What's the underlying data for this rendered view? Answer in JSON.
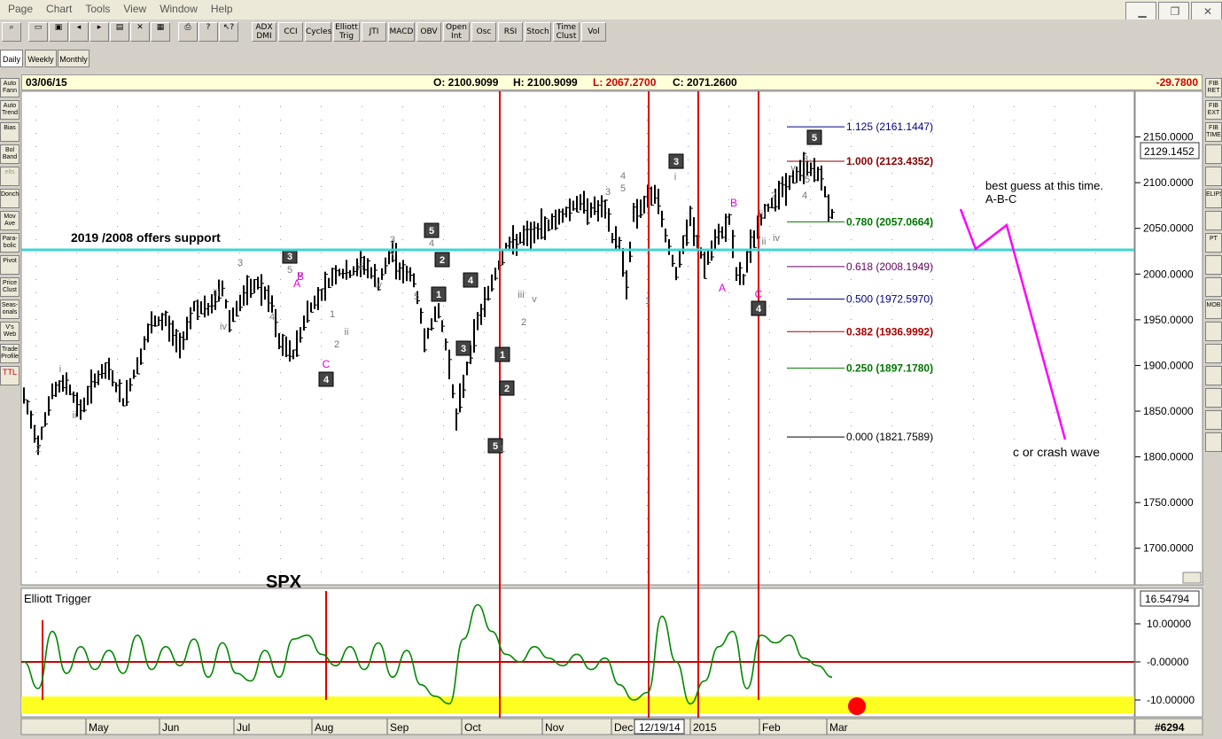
{
  "menu": [
    "Page",
    "Chart",
    "Tools",
    "View",
    "Window",
    "Help"
  ],
  "toolbar": {
    "indicators": [
      {
        "id": "adx",
        "label": "ADX DMI"
      },
      {
        "id": "cci",
        "label": "CCI"
      },
      {
        "id": "cycles",
        "label": "Cycles"
      },
      {
        "id": "elliott",
        "label": "Elliott Trig"
      },
      {
        "id": "jti",
        "label": "JTI"
      },
      {
        "id": "macd",
        "label": "MACD"
      },
      {
        "id": "obv",
        "label": "OBV"
      },
      {
        "id": "openint",
        "label": "Open Int"
      },
      {
        "id": "osc",
        "label": "Osc"
      },
      {
        "id": "rsi",
        "label": "RSI"
      },
      {
        "id": "stoch",
        "label": "Stoch"
      },
      {
        "id": "timeclust",
        "label": "Time Clust"
      },
      {
        "id": "vol",
        "label": "Vol"
      }
    ]
  },
  "tabs": [
    "Daily",
    "Weekly",
    "Monthly"
  ],
  "left_tools": [
    "Auto Fann",
    "Auto Trend",
    "Bias",
    "Bol Band",
    "elts",
    "Donch",
    "Mov Ave",
    "Para- bolic",
    "Pivot",
    "Price Clust",
    "Seas- onals",
    "V's Web",
    "Trade Profile",
    "TTL"
  ],
  "right_tools": [
    "FIB RET",
    "FIB EXT",
    "FIB TIME",
    "",
    "",
    "ELIPSE",
    "",
    "PT",
    "",
    "",
    "MOB",
    "",
    "",
    "",
    "",
    "",
    ""
  ],
  "info": {
    "date": "03/06/15",
    "open": "O: 2100.9099",
    "high": "H: 2100.9099",
    "low": "L: 2067.2700",
    "close": "C: 2071.2600",
    "change": "-29.7800"
  },
  "colors": {
    "support": "#3fd4d4",
    "cycle": "#dd0000",
    "price": "#000000",
    "abc": "#ff00ff",
    "trigger": "#008800",
    "zero": "#cc0000",
    "highlight": "#ffff22"
  },
  "price_axis": {
    "ticks": [
      "2150.0000",
      "2100.0000",
      "2050.0000",
      "2000.0000",
      "1950.0000",
      "1900.0000",
      "1850.0000",
      "1800.0000",
      "1750.0000",
      "1700.0000"
    ],
    "current": "2129.1452"
  },
  "trigger_axis": {
    "ticks": [
      "10.00000",
      "-0.00000",
      "-10.00000"
    ],
    "current": "16.54794"
  },
  "months": [
    "May",
    "Jun",
    "Jul",
    "Aug",
    "Sep",
    "Oct",
    "Nov",
    "Dec",
    "12/19/14",
    "2015",
    "Feb",
    "Mar"
  ],
  "bar_count": "#6294",
  "fib_levels": [
    {
      "label": "1.125 (2161.1447)",
      "color": "#000088"
    },
    {
      "label": "1.000 (2123.4352)",
      "color": "#880000"
    },
    {
      "label": "0.780 (2057.0664)",
      "color": "#007700"
    },
    {
      "label": "0.618 (2008.1949)",
      "color": "#660066"
    },
    {
      "label": "0.500 (1972.5970)",
      "color": "#000088"
    },
    {
      "label": "0.382 (1936.9992)",
      "color": "#aa0000"
    },
    {
      "label": "0.250 (1897.1780)",
      "color": "#007700"
    },
    {
      "label": "0.000 (1821.7589)",
      "color": "#000000"
    }
  ],
  "annotations": {
    "support": "2019 /2008 offers support",
    "guess1": "best guess at this time.",
    "guess2": "A-B-C",
    "crash": "c or crash wave",
    "symbol": "SPX",
    "indicator": "Elliott Trigger"
  },
  "wave_labels": {
    "boxed": [
      "3",
      "4",
      "5",
      "2",
      "1",
      "4",
      "3",
      "1",
      "2",
      "5",
      "3",
      "4",
      "5"
    ],
    "small": [
      "i",
      "ii",
      "2",
      "iii",
      "3",
      "5",
      "iv",
      "4",
      "v",
      "1",
      "2",
      "ii",
      "iii",
      "iv",
      "3",
      "v",
      "4",
      "5",
      "1",
      "2",
      "iii",
      "v",
      "3",
      "5",
      "4",
      "i",
      "1",
      "2",
      "ii",
      "iii",
      "iv",
      "v",
      "4",
      "3",
      "5"
    ],
    "abc": [
      "A",
      "B",
      "C",
      "B",
      "A",
      "C"
    ]
  },
  "chart_data": {
    "type": "bar",
    "title": "",
    "symbol": "SPX",
    "x_range": [
      "2014-04",
      "2015-03-06"
    ],
    "ylim": [
      1660,
      2200
    ],
    "support_level": 2019,
    "fib_retracement": {
      "low": 1821.7589,
      "high": 2123.4352,
      "levels": [
        [
          1.125,
          2161.1447
        ],
        [
          1.0,
          2123.4352
        ],
        [
          0.78,
          2057.0664
        ],
        [
          0.618,
          2008.1949
        ],
        [
          0.5,
          1972.597
        ],
        [
          0.382,
          1936.9992
        ],
        [
          0.25,
          1897.178
        ],
        [
          0.0,
          1821.7589
        ]
      ]
    },
    "last_bar": {
      "date": "2015-03-06",
      "open": 2100.9099,
      "high": 2100.9099,
      "low": 2067.27,
      "close": 2071.26,
      "change": -29.78
    },
    "price_path": [
      [
        0,
        1865
      ],
      [
        4,
        1815
      ],
      [
        8,
        1870
      ],
      [
        12,
        1882
      ],
      [
        16,
        1850
      ],
      [
        20,
        1885
      ],
      [
        24,
        1895
      ],
      [
        28,
        1860
      ],
      [
        32,
        1900
      ],
      [
        36,
        1945
      ],
      [
        40,
        1950
      ],
      [
        44,
        1920
      ],
      [
        48,
        1965
      ],
      [
        52,
        1960
      ],
      [
        56,
        1985
      ],
      [
        58,
        1950
      ],
      [
        62,
        1975
      ],
      [
        66,
        1990
      ],
      [
        70,
        1965
      ],
      [
        72,
        1925
      ],
      [
        76,
        1912
      ],
      [
        80,
        1958
      ],
      [
        84,
        1980
      ],
      [
        88,
        2002
      ],
      [
        92,
        2000
      ],
      [
        96,
        2012
      ],
      [
        100,
        1990
      ],
      [
        104,
        2025
      ],
      [
        106,
        2005
      ],
      [
        110,
        1995
      ],
      [
        113,
        1930
      ],
      [
        117,
        1960
      ],
      [
        120,
        1905
      ],
      [
        122,
        1840
      ],
      [
        124,
        1880
      ],
      [
        128,
        1948
      ],
      [
        132,
        1990
      ],
      [
        136,
        2030
      ],
      [
        140,
        2038
      ],
      [
        144,
        2045
      ],
      [
        148,
        2055
      ],
      [
        152,
        2065
      ],
      [
        156,
        2078
      ],
      [
        160,
        2072
      ],
      [
        164,
        2070
      ],
      [
        166,
        2040
      ],
      [
        168,
        2035
      ],
      [
        170,
        1990
      ],
      [
        172,
        2065
      ],
      [
        176,
        2080
      ],
      [
        178,
        2090
      ],
      [
        180,
        2060
      ],
      [
        184,
        2000
      ],
      [
        188,
        2060
      ],
      [
        192,
        2010
      ],
      [
        196,
        2040
      ],
      [
        199,
        2060
      ],
      [
        201,
        2000
      ],
      [
        203,
        1995
      ],
      [
        205,
        2030
      ],
      [
        208,
        2060
      ],
      [
        212,
        2085
      ],
      [
        216,
        2100
      ],
      [
        220,
        2117
      ],
      [
        224,
        2112
      ],
      [
        228,
        2065
      ]
    ],
    "elliott_trigger": [
      [
        0,
        0
      ],
      [
        4,
        -7
      ],
      [
        8,
        8
      ],
      [
        12,
        -3
      ],
      [
        16,
        4
      ],
      [
        20,
        -2
      ],
      [
        24,
        3
      ],
      [
        28,
        -3
      ],
      [
        32,
        7
      ],
      [
        36,
        -2
      ],
      [
        40,
        4
      ],
      [
        44,
        -1
      ],
      [
        48,
        6
      ],
      [
        52,
        -4
      ],
      [
        56,
        5
      ],
      [
        60,
        -3
      ],
      [
        64,
        -5
      ],
      [
        68,
        3
      ],
      [
        72,
        -4
      ],
      [
        76,
        6
      ],
      [
        80,
        7
      ],
      [
        84,
        2
      ],
      [
        88,
        -1
      ],
      [
        92,
        4
      ],
      [
        96,
        -2
      ],
      [
        100,
        5
      ],
      [
        104,
        -4
      ],
      [
        108,
        3
      ],
      [
        112,
        -6
      ],
      [
        116,
        -9
      ],
      [
        120,
        -11
      ],
      [
        124,
        6
      ],
      [
        128,
        15
      ],
      [
        132,
        8
      ],
      [
        136,
        2
      ],
      [
        140,
        0
      ],
      [
        144,
        4
      ],
      [
        148,
        1
      ],
      [
        152,
        -1
      ],
      [
        156,
        2
      ],
      [
        160,
        -2
      ],
      [
        164,
        1
      ],
      [
        168,
        -6
      ],
      [
        172,
        -10
      ],
      [
        176,
        -8
      ],
      [
        180,
        12
      ],
      [
        184,
        0
      ],
      [
        188,
        -11
      ],
      [
        192,
        -5
      ],
      [
        196,
        4
      ],
      [
        200,
        8
      ],
      [
        204,
        -7
      ],
      [
        208,
        7
      ],
      [
        212,
        5
      ],
      [
        216,
        7
      ],
      [
        220,
        1
      ],
      [
        224,
        -1
      ],
      [
        228,
        -4
      ]
    ],
    "cycle_lines": [
      "2014-04",
      "2014-08",
      "2014-10-15",
      "2014-12-16",
      "2015-01-05",
      "2015-01-30"
    ],
    "forecast": "A-B-C then c or crash wave"
  }
}
